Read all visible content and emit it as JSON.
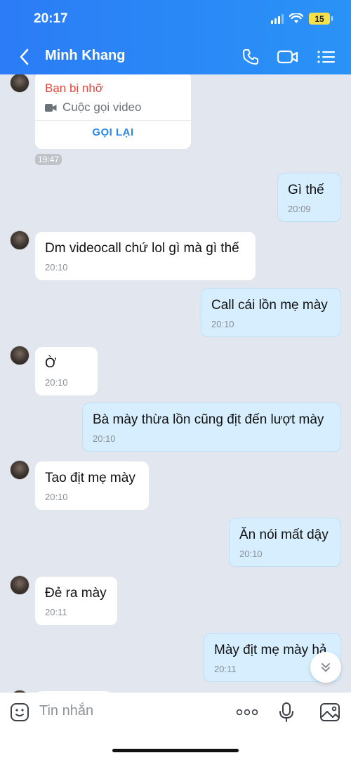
{
  "status_bar": {
    "time": "20:17",
    "battery": "15"
  },
  "header": {
    "contact_name": "Minh Khang"
  },
  "missed_call": {
    "title": "Bạn bị nhỡ",
    "subtitle": "Cuộc gọi video",
    "action": "GỌI LẠI",
    "time": "19:47"
  },
  "messages": [
    {
      "dir": "out",
      "text": "Gì thế",
      "time": "20:09"
    },
    {
      "dir": "in",
      "text": "Dm videocall chứ lol gì mà gì thế",
      "time": "20:10"
    },
    {
      "dir": "out",
      "text": "Call cái lồn mẹ mày",
      "time": "20:10"
    },
    {
      "dir": "in",
      "text": "Ờ",
      "time": "20:10"
    },
    {
      "dir": "out",
      "text": "Bà mày thừa lồn cũng địt đến lượt mày",
      "time": "20:10"
    },
    {
      "dir": "in",
      "text": "Tao địt mẹ mày",
      "time": "20:10"
    },
    {
      "dir": "out",
      "text": "Ăn nói mất dậy",
      "time": "20:10"
    },
    {
      "dir": "in",
      "text": "Đẻ ra mày",
      "time": "20:11"
    },
    {
      "dir": "out",
      "text": "Mày địt mẹ mày hả",
      "time": "20:11"
    }
  ],
  "input": {
    "placeholder": "Tin nhắn"
  },
  "colors": {
    "header": "#2b7cf6",
    "outgoing_bubble": "#d6eefd",
    "missed_call": "#e0483e",
    "link": "#2a86e9"
  }
}
